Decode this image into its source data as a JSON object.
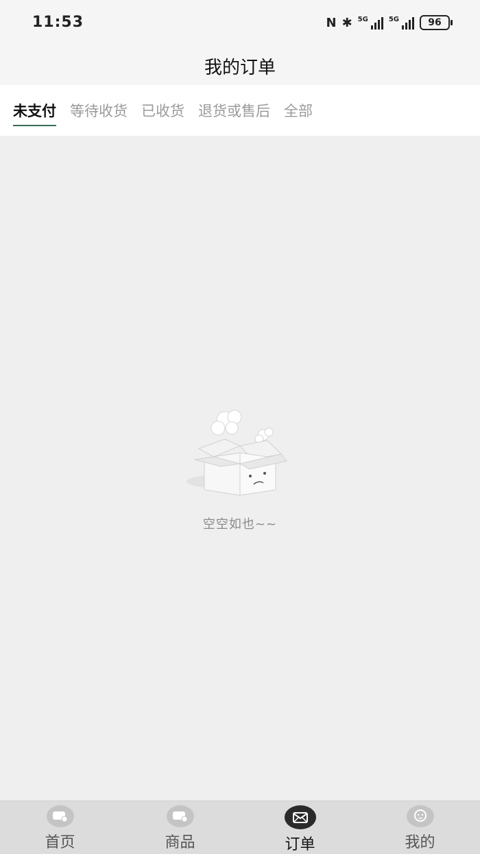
{
  "status_bar": {
    "time": "11:53",
    "nfc": "N",
    "bluetooth": "✱",
    "network1": "5G",
    "network2": "5G",
    "battery": "96"
  },
  "header": {
    "title": "我的订单"
  },
  "tabs": [
    {
      "label": "未支付",
      "active": true
    },
    {
      "label": "等待收货",
      "active": false
    },
    {
      "label": "已收货",
      "active": false
    },
    {
      "label": "退货或售后",
      "active": false
    },
    {
      "label": "全部",
      "active": false
    }
  ],
  "empty_state": {
    "text": "空空如也~~",
    "icon": "empty-box-icon"
  },
  "bottom_nav": [
    {
      "label": "首页",
      "icon": "home-icon"
    },
    {
      "label": "商品",
      "icon": "goods-icon"
    },
    {
      "label": "订单",
      "icon": "envelope-icon",
      "active": true
    },
    {
      "label": "我的",
      "icon": "profile-icon"
    }
  ],
  "colors": {
    "accent": "#3a6b55",
    "background": "#efefef",
    "nav_bg": "#dcdcdc"
  }
}
